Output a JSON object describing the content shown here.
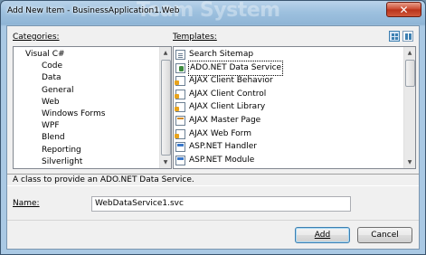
{
  "window": {
    "title": "Add New Item - BusinessApplication1.Web",
    "watermark": "Team System",
    "close_glyph": "✕"
  },
  "categories": {
    "label": "Categories:",
    "items": [
      {
        "label": "Visual C#",
        "level": 0
      },
      {
        "label": "Code",
        "level": 1
      },
      {
        "label": "Data",
        "level": 1
      },
      {
        "label": "General",
        "level": 1
      },
      {
        "label": "Web",
        "level": 1
      },
      {
        "label": "Windows Forms",
        "level": 1
      },
      {
        "label": "WPF",
        "level": 1
      },
      {
        "label": "Blend",
        "level": 1
      },
      {
        "label": "Reporting",
        "level": 1
      },
      {
        "label": "Silverlight",
        "level": 1
      }
    ]
  },
  "templates": {
    "label": "Templates:",
    "items": [
      {
        "label": "Search Sitemap",
        "icon": "page-icon",
        "selected": false
      },
      {
        "label": "ADO.NET Data Service",
        "icon": "data-service-icon",
        "selected": true
      },
      {
        "label": "AJAX Client Behavior",
        "icon": "ajax-icon",
        "selected": false
      },
      {
        "label": "AJAX Client Control",
        "icon": "ajax-icon",
        "selected": false
      },
      {
        "label": "AJAX Client Library",
        "icon": "ajax-icon",
        "selected": false
      },
      {
        "label": "AJAX Master Page",
        "icon": "master-page-icon",
        "selected": false
      },
      {
        "label": "AJAX Web Form",
        "icon": "ajax-icon",
        "selected": false
      },
      {
        "label": "ASP.NET Handler",
        "icon": "asp-icon",
        "selected": false
      },
      {
        "label": "ASP.NET Module",
        "icon": "asp-icon",
        "selected": false
      },
      {
        "label": "",
        "icon": "more-icon",
        "selected": false
      }
    ]
  },
  "description": "A class to provide an ADO.NET Data Service.",
  "name_field": {
    "label": "Name:",
    "value": "WebDataService1.svc"
  },
  "buttons": {
    "add": "Add",
    "cancel": "Cancel"
  },
  "colors": {
    "title_gradient_top": "#b9d3ea",
    "client_bg": "#f0f0f0",
    "default_button_border": "#3c7fb1"
  }
}
